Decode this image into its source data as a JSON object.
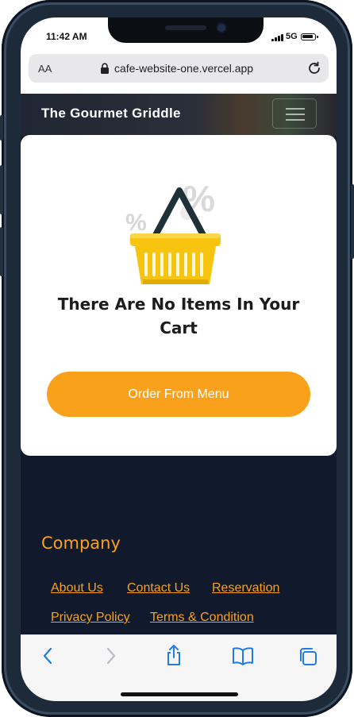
{
  "status_bar": {
    "time": "11:42 AM",
    "network": "5G"
  },
  "browser": {
    "text_size_label": "AA",
    "url": "cafe-website-one.vercel.app"
  },
  "navbar": {
    "brand": "The Gourmet Griddle"
  },
  "cart": {
    "empty_message": "There Are No Items In Your Cart",
    "order_button_label": "Order From Menu"
  },
  "footer": {
    "section_title": "Company",
    "links": [
      "About Us",
      "Contact Us",
      "Reservation",
      "Privacy Policy",
      "Terms & Condition"
    ]
  },
  "colors": {
    "accent": "#f9a11b",
    "footer_bg": "#111a2c",
    "basket": "#f7c510"
  },
  "icons": [
    "lock-icon",
    "reload-icon",
    "menu-icon",
    "back-icon",
    "forward-icon",
    "share-icon",
    "bookmarks-icon",
    "tabs-icon"
  ]
}
